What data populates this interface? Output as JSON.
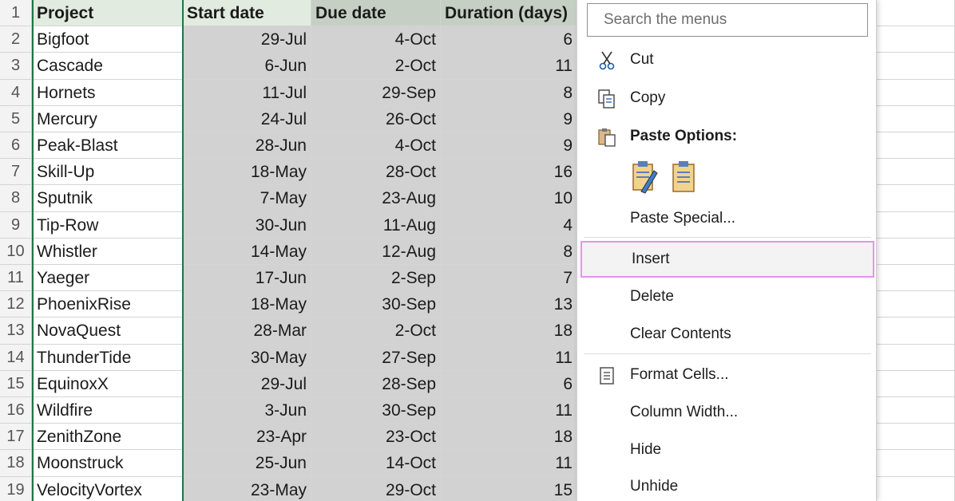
{
  "sheet": {
    "headers": [
      "Project",
      "Start date",
      "Due date",
      "Duration (days)"
    ],
    "row_numbers": [
      "1",
      "2",
      "3",
      "4",
      "5",
      "6",
      "7",
      "8",
      "9",
      "10",
      "11",
      "12",
      "13",
      "14",
      "15",
      "16",
      "17",
      "18",
      "19"
    ],
    "rows": [
      {
        "project": "Bigfoot",
        "start": "29-Jul",
        "due": "4-Oct",
        "dur": "6"
      },
      {
        "project": "Cascade",
        "start": "6-Jun",
        "due": "2-Oct",
        "dur": "11"
      },
      {
        "project": "Hornets",
        "start": "11-Jul",
        "due": "29-Sep",
        "dur": "8"
      },
      {
        "project": "Mercury",
        "start": "24-Jul",
        "due": "26-Oct",
        "dur": "9"
      },
      {
        "project": "Peak-Blast",
        "start": "28-Jun",
        "due": "4-Oct",
        "dur": "9"
      },
      {
        "project": "Skill-Up",
        "start": "18-May",
        "due": "28-Oct",
        "dur": "16"
      },
      {
        "project": "Sputnik",
        "start": "7-May",
        "due": "23-Aug",
        "dur": "10"
      },
      {
        "project": "Tip-Row",
        "start": "30-Jun",
        "due": "11-Aug",
        "dur": "4"
      },
      {
        "project": "Whistler",
        "start": "14-May",
        "due": "12-Aug",
        "dur": "8"
      },
      {
        "project": "Yaeger",
        "start": "17-Jun",
        "due": "2-Sep",
        "dur": "7"
      },
      {
        "project": "PhoenixRise",
        "start": "18-May",
        "due": "30-Sep",
        "dur": "13"
      },
      {
        "project": "NovaQuest",
        "start": "28-Mar",
        "due": "2-Oct",
        "dur": "18"
      },
      {
        "project": "ThunderTide",
        "start": "30-May",
        "due": "27-Sep",
        "dur": "11"
      },
      {
        "project": "EquinoxX",
        "start": "29-Jul",
        "due": "28-Sep",
        "dur": "6"
      },
      {
        "project": "Wildfire",
        "start": "3-Jun",
        "due": "30-Sep",
        "dur": "11"
      },
      {
        "project": "ZenithZone",
        "start": "23-Apr",
        "due": "23-Oct",
        "dur": "18"
      },
      {
        "project": "Moonstruck",
        "start": "25-Jun",
        "due": "14-Oct",
        "dur": "11"
      },
      {
        "project": "VelocityVortex",
        "start": "23-May",
        "due": "29-Oct",
        "dur": "15"
      }
    ]
  },
  "menu": {
    "search_placeholder": "Search the menus",
    "cut": "Cut",
    "copy": "Copy",
    "paste_options": "Paste Options:",
    "paste_special": "Paste Special...",
    "insert": "Insert",
    "delete": "Delete",
    "clear_contents": "Clear Contents",
    "format_cells": "Format Cells...",
    "column_width": "Column Width...",
    "hide": "Hide",
    "unhide": "Unhide"
  },
  "colors": {
    "selection_border": "#217346",
    "highlight_border": "#e196e8",
    "selected_fill": "#d2d2d2"
  },
  "icons": [
    "scissors-icon",
    "copy-icon",
    "paste-icon",
    "paste-formatting-icon",
    "paste-values-icon",
    "format-cells-icon"
  ]
}
